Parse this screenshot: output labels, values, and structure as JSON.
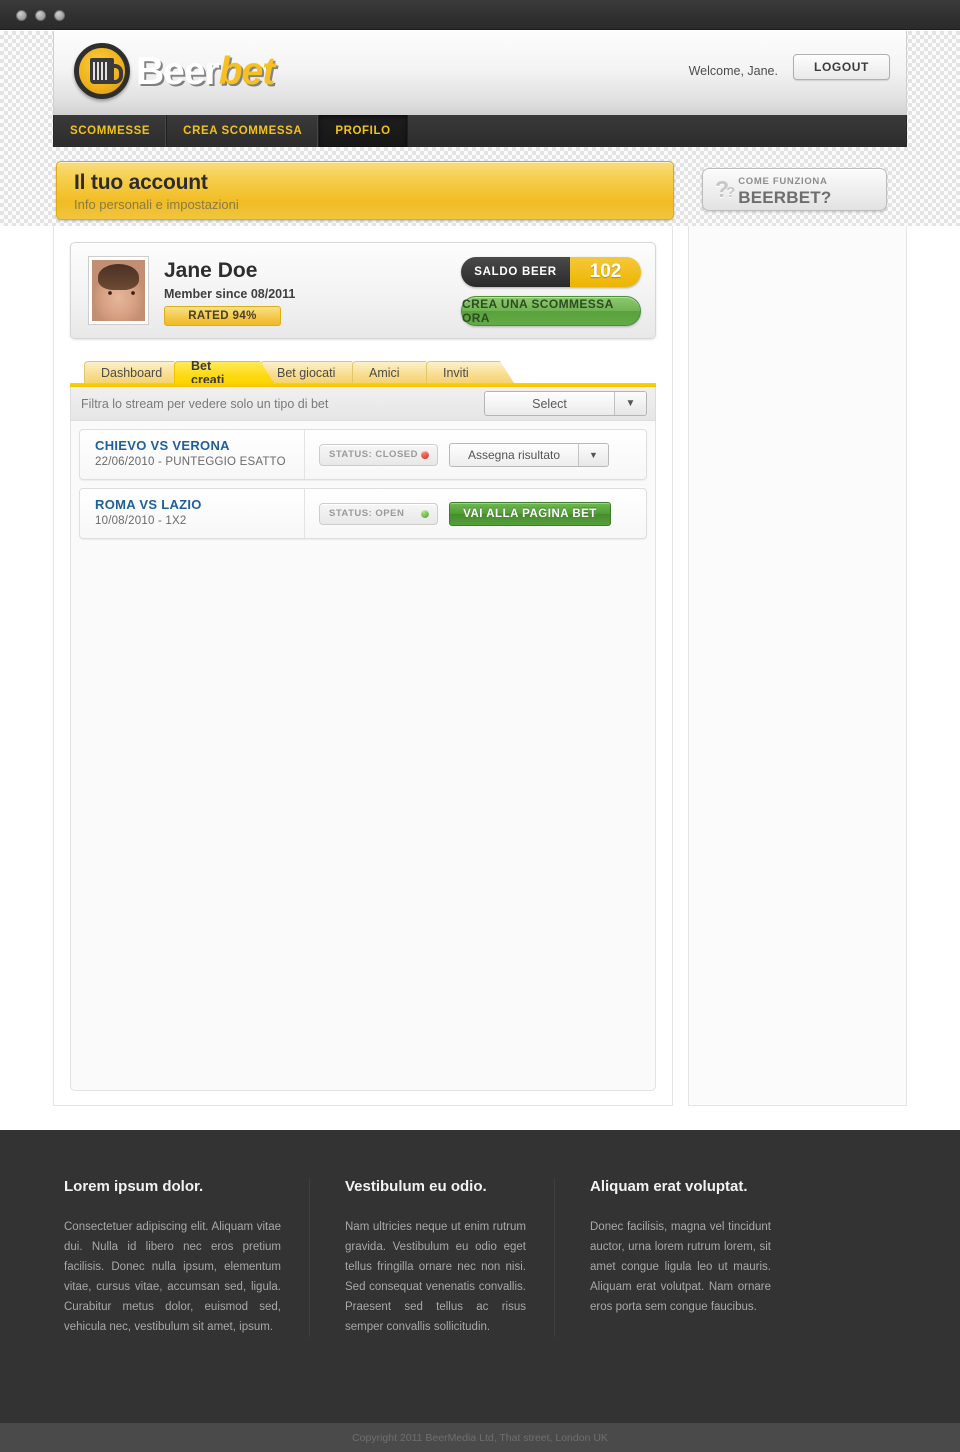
{
  "brand": {
    "name_part1": "Beer",
    "name_part2": "bet",
    "logo_icon": "beer-mug-icon"
  },
  "header": {
    "welcome": "Welcome, Jane.",
    "logout_label": "LOGOUT"
  },
  "nav": {
    "items": [
      {
        "label": "SCOMMESSE",
        "active": false
      },
      {
        "label": "CREA SCOMMESSA",
        "active": false
      },
      {
        "label": "PROFILO",
        "active": true
      }
    ]
  },
  "page_head": {
    "title": "Il tuo account",
    "subtitle": "Info personali e impostazioni"
  },
  "how_it_works": {
    "question_marks": "?",
    "line1": "COME FUNZIONA",
    "line2": "BEERBET?"
  },
  "profile": {
    "name": "Jane Doe",
    "member_since": "Member since 08/2011",
    "rated": "RATED 94%",
    "balance_label": "SALDO BEER",
    "balance_value": "102",
    "cta_label": "CREA UNA SCOMMESSA ORA"
  },
  "tabs": [
    {
      "label": "Dashboard",
      "active": false
    },
    {
      "label": "Bet creati",
      "active": true
    },
    {
      "label": "Bet giocati",
      "active": false
    },
    {
      "label": "Amici",
      "active": false
    },
    {
      "label": "Inviti",
      "active": false
    }
  ],
  "filter": {
    "label": "Filtra lo stream per vedere solo un tipo di bet",
    "select_value": "Select",
    "select_arrow": "▼"
  },
  "bets": [
    {
      "title": "CHIEVO VS VERONA",
      "meta": "22/06/2010 - PUNTEGGIO ESATTO",
      "status_label": "STATUS: CLOSED",
      "status_color": "#d52a18",
      "action_type": "select",
      "action_label": "Assegna risultato",
      "action_arrow": "▼"
    },
    {
      "title": "ROMA VS LAZIO",
      "meta": "10/08/2010 - 1X2",
      "status_label": "STATUS: OPEN",
      "status_color": "#4f9b2c",
      "action_type": "button",
      "action_label": "VAI ALLA PAGINA BET",
      "action_arrow": ""
    }
  ],
  "footer": {
    "columns": [
      {
        "heading": "Lorem ipsum dolor.",
        "body": "Consectetuer adipiscing elit. Aliquam vitae dui. Nulla id libero nec eros pretium facilisis. Donec nulla ipsum, elementum vitae, cursus vitae, accumsan sed, ligula. Curabitur metus dolor, euismod sed, vehicula nec, vestibulum sit amet, ipsum."
      },
      {
        "heading": "Vestibulum eu odio.",
        "body": "Nam ultricies neque ut enim rutrum gravida. Vestibulum eu odio eget tellus fringilla ornare nec non nisi. Sed consequat venenatis convallis. Praesent sed tellus ac risus semper convallis sollicitudin."
      },
      {
        "heading": "Aliquam erat voluptat.",
        "body": "Donec facilisis, magna vel tincidunt auctor, urna lorem rutrum lorem, sit amet congue ligula leo ut mauris. Aliquam erat volutpat. Nam ornare eros porta sem congue faucibus."
      }
    ],
    "copyright": "Copyright 2011 BeerMedia Ltd, That street, London UK"
  },
  "colors": {
    "brand_yellow": "#f2c21c",
    "accent_green": "#4f9c33",
    "link_blue": "#1f5f9c",
    "dark_nav": "#2c2c2c"
  }
}
